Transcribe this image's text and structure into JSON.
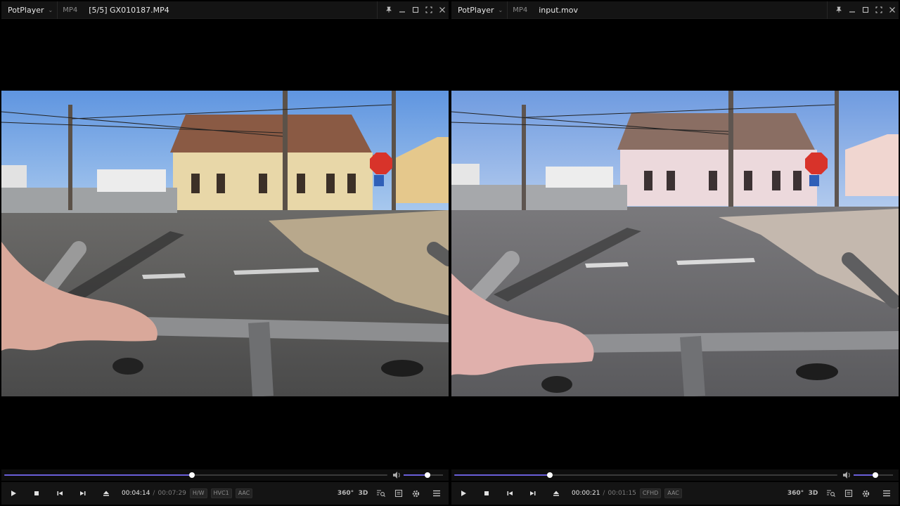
{
  "players": {
    "left": {
      "app_name": "PotPlayer",
      "format": "MP4",
      "filename": "[5/5] GX010187.MP4",
      "current_time": "00:04:14",
      "total_time": "00:07:29",
      "badges": [
        "H/W",
        "HVC1",
        "AAC"
      ],
      "seek_progress": 0.49,
      "volume_level": 0.6,
      "video_tint": "#e8d7a8"
    },
    "right": {
      "app_name": "PotPlayer",
      "format": "MP4",
      "filename": "input.mov",
      "current_time": "00:00:21",
      "total_time": "00:01:15",
      "badges": [
        "CFHD",
        "AAC"
      ],
      "seek_progress": 0.25,
      "volume_level": 0.55,
      "video_tint": "#ecd9dc"
    }
  },
  "toolbar_icons": {
    "vr": "360°",
    "three_d": "3D"
  },
  "colors": {
    "accent": "#6a5fd8",
    "titlebar": "#141414",
    "controlbar": "#141414",
    "background": "#000000"
  }
}
